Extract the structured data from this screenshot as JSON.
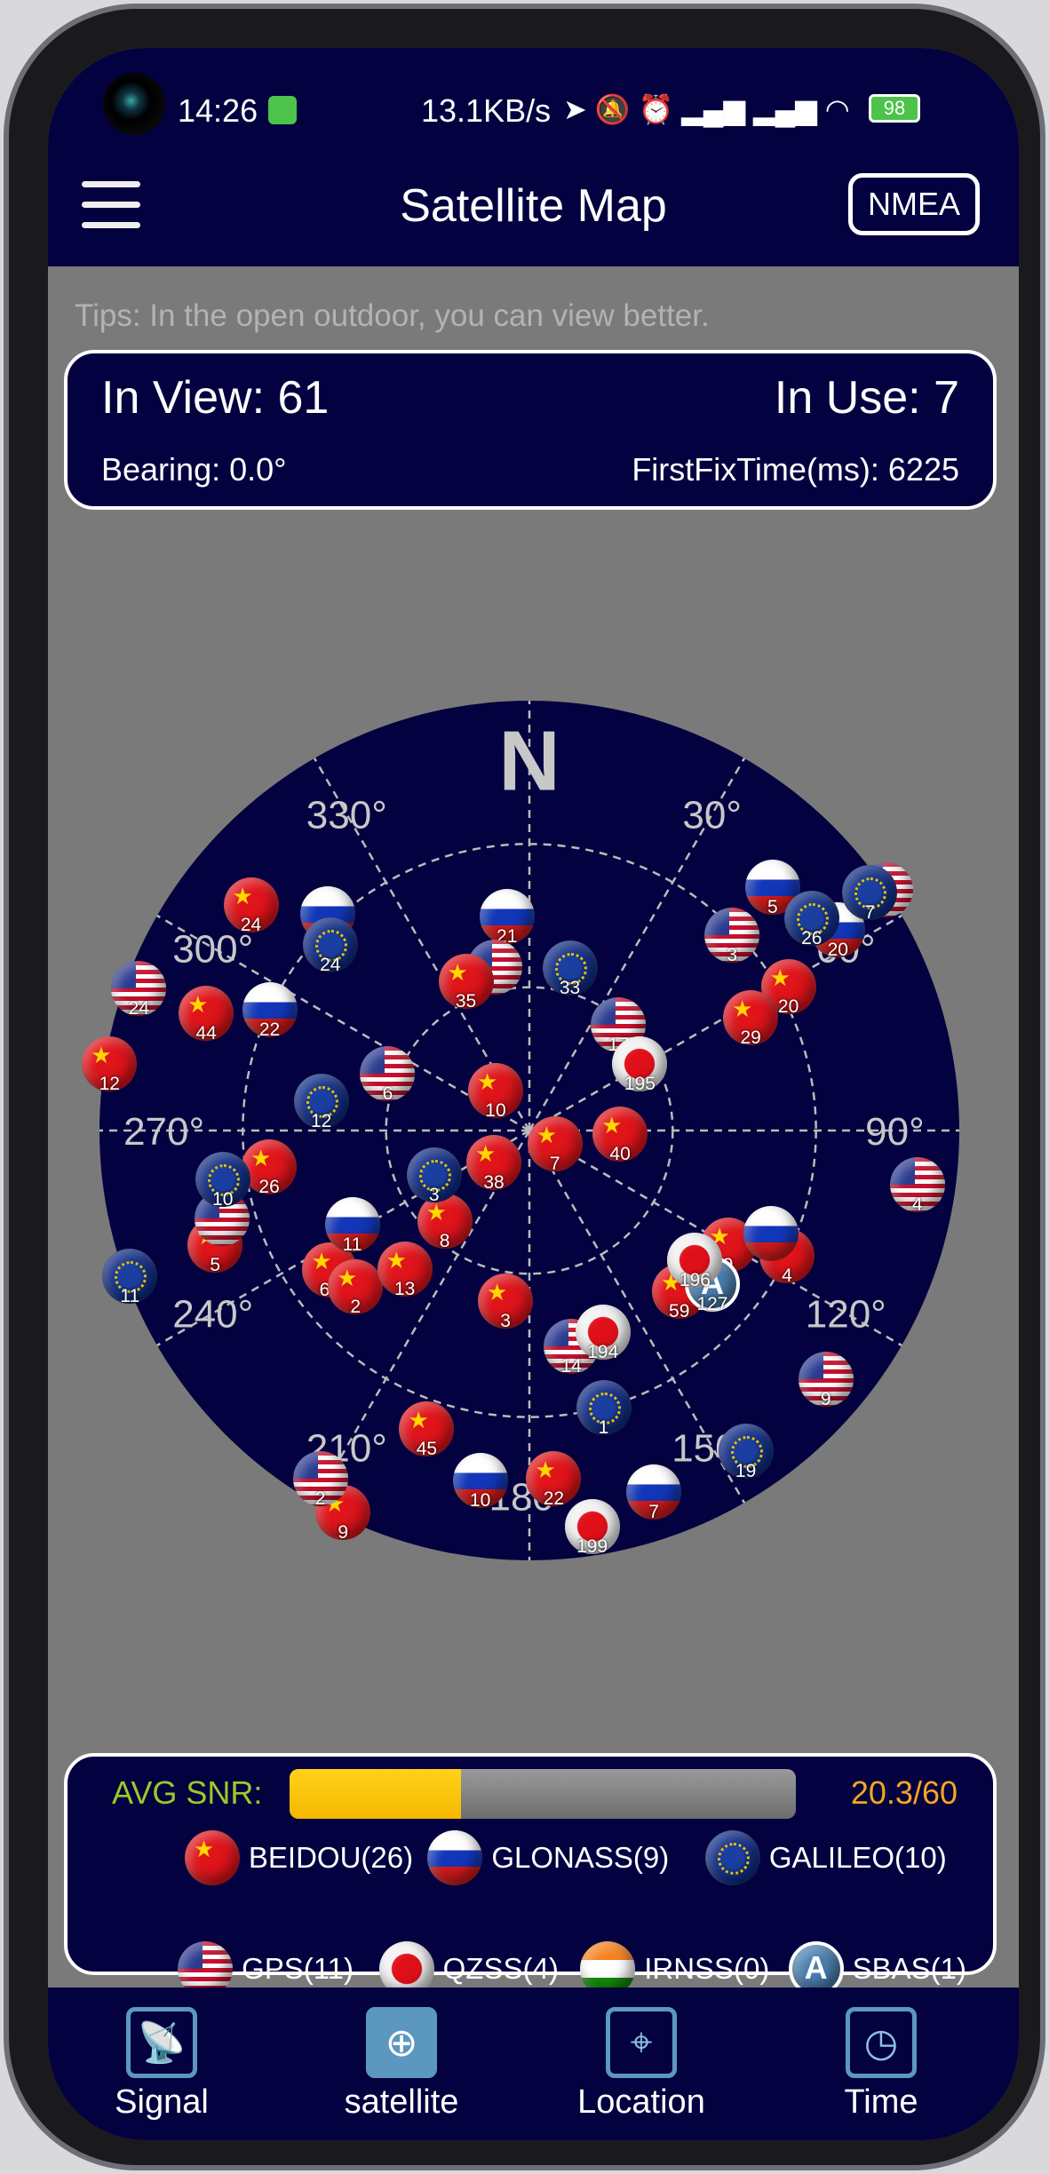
{
  "status_bar": {
    "time": "14:26",
    "net_speed": "13.1KB/s",
    "battery": "98"
  },
  "header": {
    "title": "Satellite Map",
    "nmea_label": "NMEA"
  },
  "tips": "Tips: In the open outdoor, you can view better.",
  "info": {
    "in_view": "In View: 61",
    "in_use": "In Use: 7",
    "bearing": "Bearing: 0.0°",
    "first_fix": "FirstFixTime(ms): 6225"
  },
  "radar": {
    "north": "N",
    "degree_labels": [
      "30°",
      "60°",
      "90°",
      "120°",
      "150°",
      "180°",
      "210°",
      "240°",
      "270°",
      "300°",
      "330°"
    ],
    "satellites": [
      {
        "sys": "BEIDOU",
        "prn": "24",
        "az": 309,
        "el": 15
      },
      {
        "sys": "BEIDOU",
        "prn": "44",
        "az": 290,
        "el": 18
      },
      {
        "sys": "BEIDOU",
        "prn": "12",
        "az": 279,
        "el": 1
      },
      {
        "sys": "BEIDOU",
        "prn": "10",
        "az": 320,
        "el": 79
      },
      {
        "sys": "BEIDOU",
        "prn": "26",
        "az": 262,
        "el": 35
      },
      {
        "sys": "BEIDOU",
        "prn": "5",
        "az": 250,
        "el": 20
      },
      {
        "sys": "BEIDOU",
        "prn": "38",
        "az": 228,
        "el": 80
      },
      {
        "sys": "BEIDOU",
        "prn": "7",
        "az": 117,
        "el": 84
      },
      {
        "sys": "BEIDOU",
        "prn": "40",
        "az": 92,
        "el": 71
      },
      {
        "sys": "BEIDOU",
        "prn": "8",
        "az": 223,
        "el": 64
      },
      {
        "sys": "BEIDOU",
        "prn": "60",
        "az": 235,
        "el": 39
      },
      {
        "sys": "BEIDOU",
        "prn": "2",
        "az": 228,
        "el": 41
      },
      {
        "sys": "BEIDOU",
        "prn": "13",
        "az": 222,
        "el": 51
      },
      {
        "sys": "BEIDOU",
        "prn": "3",
        "az": 188,
        "el": 54
      },
      {
        "sys": "BEIDOU",
        "prn": "45",
        "az": 199,
        "el": 24
      },
      {
        "sys": "BEIDOU",
        "prn": "9",
        "az": 206,
        "el": 1
      },
      {
        "sys": "BEIDOU",
        "prn": "22",
        "az": 176,
        "el": 17
      },
      {
        "sys": "BEIDOU",
        "prn": "20",
        "az": 61,
        "el": 28
      },
      {
        "sys": "BEIDOU",
        "prn": "29",
        "az": 63,
        "el": 38
      },
      {
        "sys": "BEIDOU",
        "prn": "59",
        "az": 137,
        "el": 44
      },
      {
        "sys": "BEIDOU",
        "prn": "9",
        "az": 120,
        "el": 42
      },
      {
        "sys": "BEIDOU",
        "prn": "4",
        "az": 116,
        "el": 30
      },
      {
        "sys": "GLONASS",
        "prn": "21",
        "az": 354,
        "el": 45
      },
      {
        "sys": "GLONASS",
        "prn": "",
        "az": 317,
        "el": 28
      },
      {
        "sys": "GLONASS",
        "prn": "22",
        "az": 295,
        "el": 30
      },
      {
        "sys": "GLONASS",
        "prn": "11",
        "az": 242,
        "el": 48
      },
      {
        "sys": "GLONASS",
        "prn": "5",
        "az": 45,
        "el": 18
      },
      {
        "sys": "GLONASS",
        "prn": "20",
        "az": 57,
        "el": 13
      },
      {
        "sys": "GLONASS",
        "prn": "10",
        "az": 188,
        "el": 16
      },
      {
        "sys": "GLONASS",
        "prn": "7",
        "az": 161,
        "el": 10
      },
      {
        "sys": "GLONASS",
        "prn": "",
        "az": 113,
        "el": 35
      },
      {
        "sys": "GPS",
        "prn": "",
        "az": 348,
        "el": 55
      },
      {
        "sys": "BEIDOU",
        "prn": "35",
        "az": 337,
        "el": 56
      },
      {
        "sys": "GALILEO",
        "prn": "24",
        "az": 313,
        "el": 33
      },
      {
        "sys": "GALILEO",
        "prn": "33",
        "az": 14,
        "el": 55
      },
      {
        "sys": "GALILEO",
        "prn": "12",
        "az": 278,
        "el": 46
      },
      {
        "sys": "GPS",
        "prn": "",
        "az": 254,
        "el": 23
      },
      {
        "sys": "GALILEO",
        "prn": "10",
        "az": 261,
        "el": 25
      },
      {
        "sys": "GALILEO",
        "prn": "11",
        "az": 250,
        "el": 1
      },
      {
        "sys": "GALILEO",
        "prn": "3",
        "az": 245,
        "el": 68
      },
      {
        "sys": "GPS",
        "prn": "",
        "az": 56,
        "el": 0
      },
      {
        "sys": "GALILEO",
        "prn": "26",
        "az": 53,
        "el": 16
      },
      {
        "sys": "GALILEO",
        "prn": "7",
        "az": 55,
        "el": 3
      },
      {
        "sys": "GALILEO",
        "prn": "1",
        "az": 165,
        "el": 30
      },
      {
        "sys": "GALILEO",
        "prn": "19",
        "az": 146,
        "el": 9
      },
      {
        "sys": "GPS",
        "prn": "24",
        "az": 290,
        "el": 3
      },
      {
        "sys": "GPS",
        "prn": "6",
        "az": 292,
        "el": 58
      },
      {
        "sys": "GPS",
        "prn": "3",
        "az": 46,
        "el": 31
      },
      {
        "sys": "GPS",
        "prn": "17",
        "az": 40,
        "el": 61
      },
      {
        "sys": "GPS",
        "prn": "4",
        "az": 98,
        "el": 8
      },
      {
        "sys": "GPS",
        "prn": "14",
        "az": 169,
        "el": 44
      },
      {
        "sys": "GPS",
        "prn": "9",
        "az": 130,
        "el": 9
      },
      {
        "sys": "GPS",
        "prn": "2",
        "az": 211,
        "el": 5
      },
      {
        "sys": "QZSS",
        "prn": "195",
        "az": 59,
        "el": 63
      },
      {
        "sys": "SBAS",
        "prn": "127",
        "az": 130,
        "el": 40
      },
      {
        "sys": "QZSS",
        "prn": "196",
        "az": 128,
        "el": 46
      },
      {
        "sys": "QZSS",
        "prn": "194",
        "az": 160,
        "el": 45
      },
      {
        "sys": "QZSS",
        "prn": "199",
        "az": 171,
        "el": 6
      }
    ]
  },
  "snr": {
    "label": "AVG SNR:",
    "value": "20.3/60",
    "level": 20.3,
    "max": 60
  },
  "legend": [
    {
      "sys": "BEIDOU",
      "label": "BEIDOU(26)"
    },
    {
      "sys": "GLONASS",
      "label": "GLONASS(9)"
    },
    {
      "sys": "GALILEO",
      "label": "GALILEO(10)"
    },
    {
      "sys": "GPS",
      "label": "GPS(11)"
    },
    {
      "sys": "QZSS",
      "label": "QZSS(4)"
    },
    {
      "sys": "IRNSS",
      "label": "IRNSS(0)"
    },
    {
      "sys": "SBAS",
      "label": "SBAS(1)"
    }
  ],
  "nav": [
    {
      "label": "Signal",
      "icon": "satellite-dish-icon"
    },
    {
      "label": "satellite",
      "icon": "globe-icon",
      "active": true
    },
    {
      "label": "Location",
      "icon": "location-pin-icon"
    },
    {
      "label": "Time",
      "icon": "clock-icon"
    }
  ],
  "colors": {
    "header_bg": "#03013f",
    "content_bg": "#7a7a7a",
    "snr_fill": "#f5b800",
    "snr_label": "#9bc92a",
    "snr_value": "#f5a623"
  }
}
